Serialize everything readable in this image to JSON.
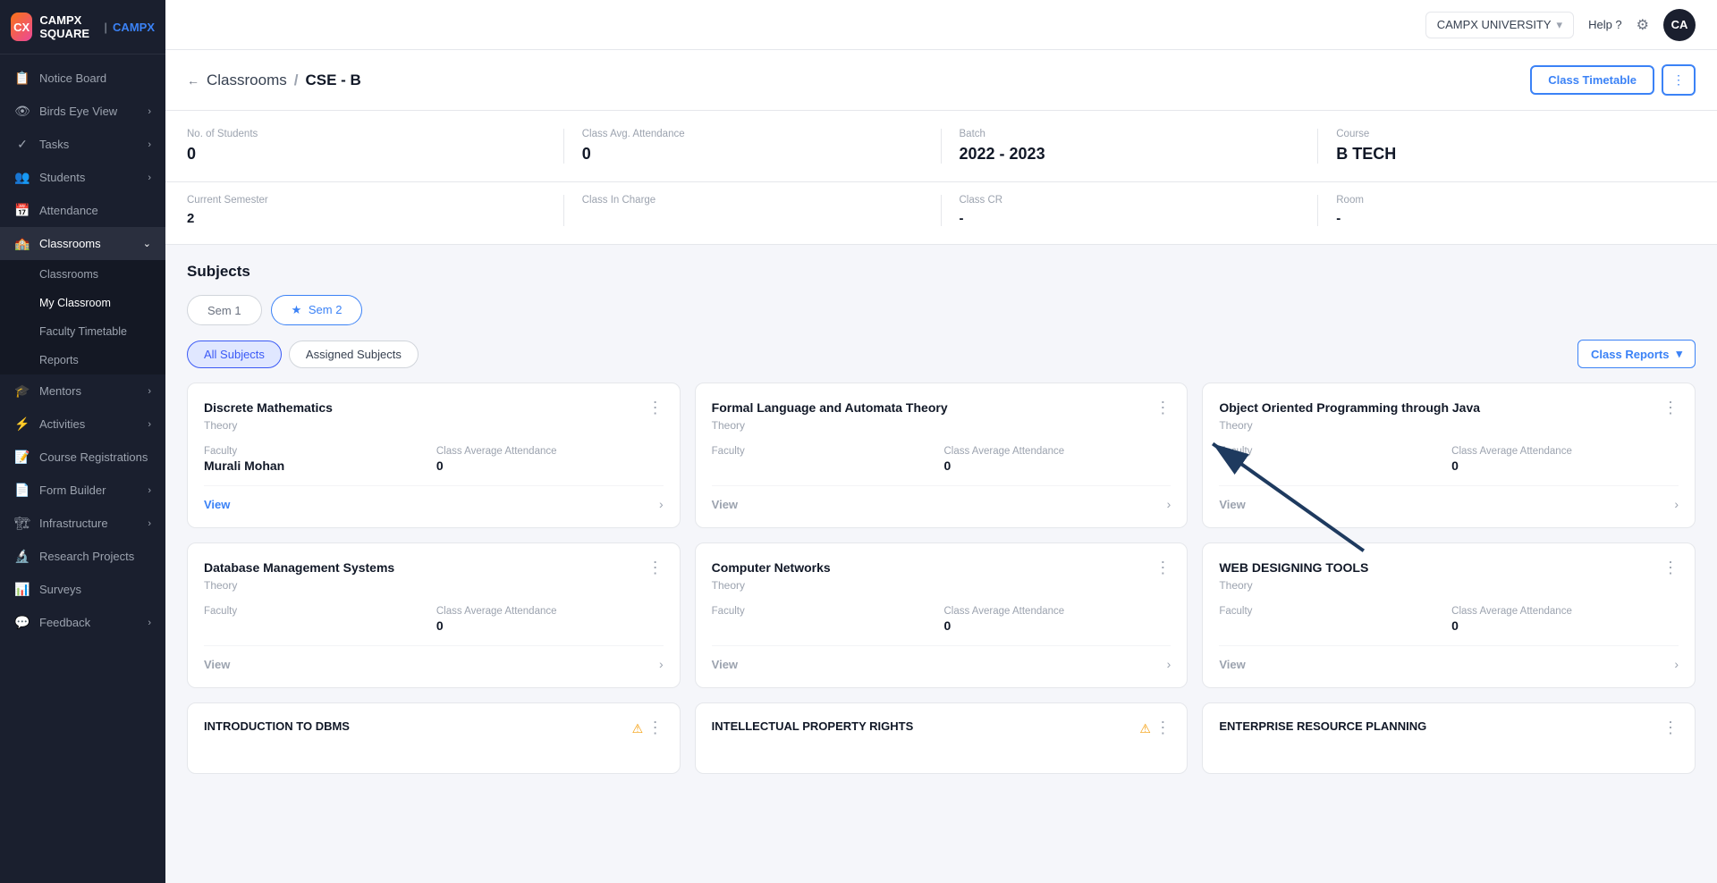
{
  "sidebar": {
    "logo": {
      "icon_text": "CX",
      "brand_prefix": "CAMPX SQUARE",
      "separator": "|",
      "brand_suffix": "CAMPX"
    },
    "nav_items": [
      {
        "id": "notice-board",
        "label": "Notice Board",
        "icon": "📋",
        "has_children": false
      },
      {
        "id": "birds-eye-view",
        "label": "Birds Eye View",
        "icon": "👁",
        "has_children": true
      },
      {
        "id": "tasks",
        "label": "Tasks",
        "icon": "✓",
        "has_children": true
      },
      {
        "id": "students",
        "label": "Students",
        "icon": "👥",
        "has_children": true
      },
      {
        "id": "attendance",
        "label": "Attendance",
        "icon": "📅",
        "has_children": false
      },
      {
        "id": "classrooms",
        "label": "Classrooms",
        "icon": "🏫",
        "has_children": true,
        "expanded": true
      },
      {
        "id": "mentors",
        "label": "Mentors",
        "icon": "🎓",
        "has_children": true
      },
      {
        "id": "activities",
        "label": "Activities",
        "icon": "⚡",
        "has_children": true
      },
      {
        "id": "course-registrations",
        "label": "Course Registrations",
        "icon": "📝",
        "has_children": false
      },
      {
        "id": "form-builder",
        "label": "Form Builder",
        "icon": "📄",
        "has_children": true
      },
      {
        "id": "infrastructure",
        "label": "Infrastructure",
        "icon": "🏗",
        "has_children": true
      },
      {
        "id": "research-projects",
        "label": "Research Projects",
        "icon": "🔬",
        "has_children": false
      },
      {
        "id": "surveys",
        "label": "Surveys",
        "icon": "📊",
        "has_children": false
      },
      {
        "id": "feedback",
        "label": "Feedback",
        "icon": "💬",
        "has_children": true
      }
    ],
    "classrooms_sub": [
      {
        "id": "classrooms-sub",
        "label": "Classrooms"
      },
      {
        "id": "my-classroom",
        "label": "My Classroom",
        "active": true
      },
      {
        "id": "faculty-timetable",
        "label": "Faculty Timetable"
      },
      {
        "id": "reports",
        "label": "Reports"
      }
    ]
  },
  "header": {
    "university": "CAMPX UNIVERSITY",
    "help_label": "Help ?",
    "avatar_initials": "CA"
  },
  "breadcrumb": {
    "back_label": "←",
    "parent": "Classrooms",
    "separator": "/",
    "current": "CSE - B"
  },
  "actions": {
    "timetable_label": "Class Timetable",
    "more_label": "⋮",
    "class_reports_label": "Class Reports",
    "class_reports_chevron": "▾"
  },
  "stats_row1": [
    {
      "label": "No. of Students",
      "value": "0"
    },
    {
      "label": "Class Avg. Attendance",
      "value": "0"
    },
    {
      "label": "Batch",
      "value": "2022 - 2023"
    },
    {
      "label": "Course",
      "value": "B TECH"
    }
  ],
  "stats_row2": [
    {
      "label": "Current Semester",
      "value": "2"
    },
    {
      "label": "Class In Charge",
      "value": ""
    },
    {
      "label": "Class CR",
      "value": "-"
    },
    {
      "label": "Room",
      "value": "-"
    }
  ],
  "subjects": {
    "section_title": "Subjects",
    "semesters": [
      {
        "id": "sem1",
        "label": "Sem 1",
        "active": false
      },
      {
        "id": "sem2",
        "label": "Sem 2",
        "active": true,
        "starred": true
      }
    ],
    "filters": [
      {
        "id": "all",
        "label": "All Subjects",
        "active": true
      },
      {
        "id": "assigned",
        "label": "Assigned Subjects",
        "active": false
      }
    ],
    "cards": [
      {
        "title": "Discrete Mathematics",
        "type": "Theory",
        "faculty_label": "Faculty",
        "faculty_value": "Murali Mohan",
        "attendance_label": "Class Average Attendance",
        "attendance_value": "0",
        "view_label": "View",
        "has_view": true
      },
      {
        "title": "Formal Language and Automata Theory",
        "type": "Theory",
        "faculty_label": "Faculty",
        "faculty_value": "",
        "attendance_label": "Class Average Attendance",
        "attendance_value": "0",
        "view_label": "View",
        "has_view": true
      },
      {
        "title": "Object Oriented Programming through Java",
        "type": "Theory",
        "faculty_label": "Faculty",
        "faculty_value": "",
        "attendance_label": "Class Average Attendance",
        "attendance_value": "0",
        "view_label": "View",
        "has_view": true
      },
      {
        "title": "Database Management Systems",
        "type": "Theory",
        "faculty_label": "Faculty",
        "faculty_value": "",
        "attendance_label": "Class Average Attendance",
        "attendance_value": "0",
        "view_label": "View",
        "has_view": true
      },
      {
        "title": "Computer Networks",
        "type": "Theory",
        "faculty_label": "Faculty",
        "faculty_value": "",
        "attendance_label": "Class Average Attendance",
        "attendance_value": "0",
        "view_label": "View",
        "has_view": true
      },
      {
        "title": "WEB DESIGNING TOOLS",
        "type": "Theory",
        "faculty_label": "Faculty",
        "faculty_value": "",
        "attendance_label": "Class Average Attendance",
        "attendance_value": "0",
        "view_label": "View",
        "has_view": true
      }
    ],
    "bottom_cards": [
      {
        "title": "INTRODUCTION TO DBMS",
        "type": "",
        "has_warning": true
      },
      {
        "title": "INTELLECTUAL PROPERTY RIGHTS",
        "type": "",
        "has_warning": true
      },
      {
        "title": "ENTERPRISE RESOURCE PLANNING",
        "type": "",
        "has_warning": true
      }
    ]
  },
  "colors": {
    "primary": "#3b82f6",
    "sidebar_bg": "#1a1f2e",
    "accent": "#3b5af6",
    "warning": "#f59e0b"
  }
}
